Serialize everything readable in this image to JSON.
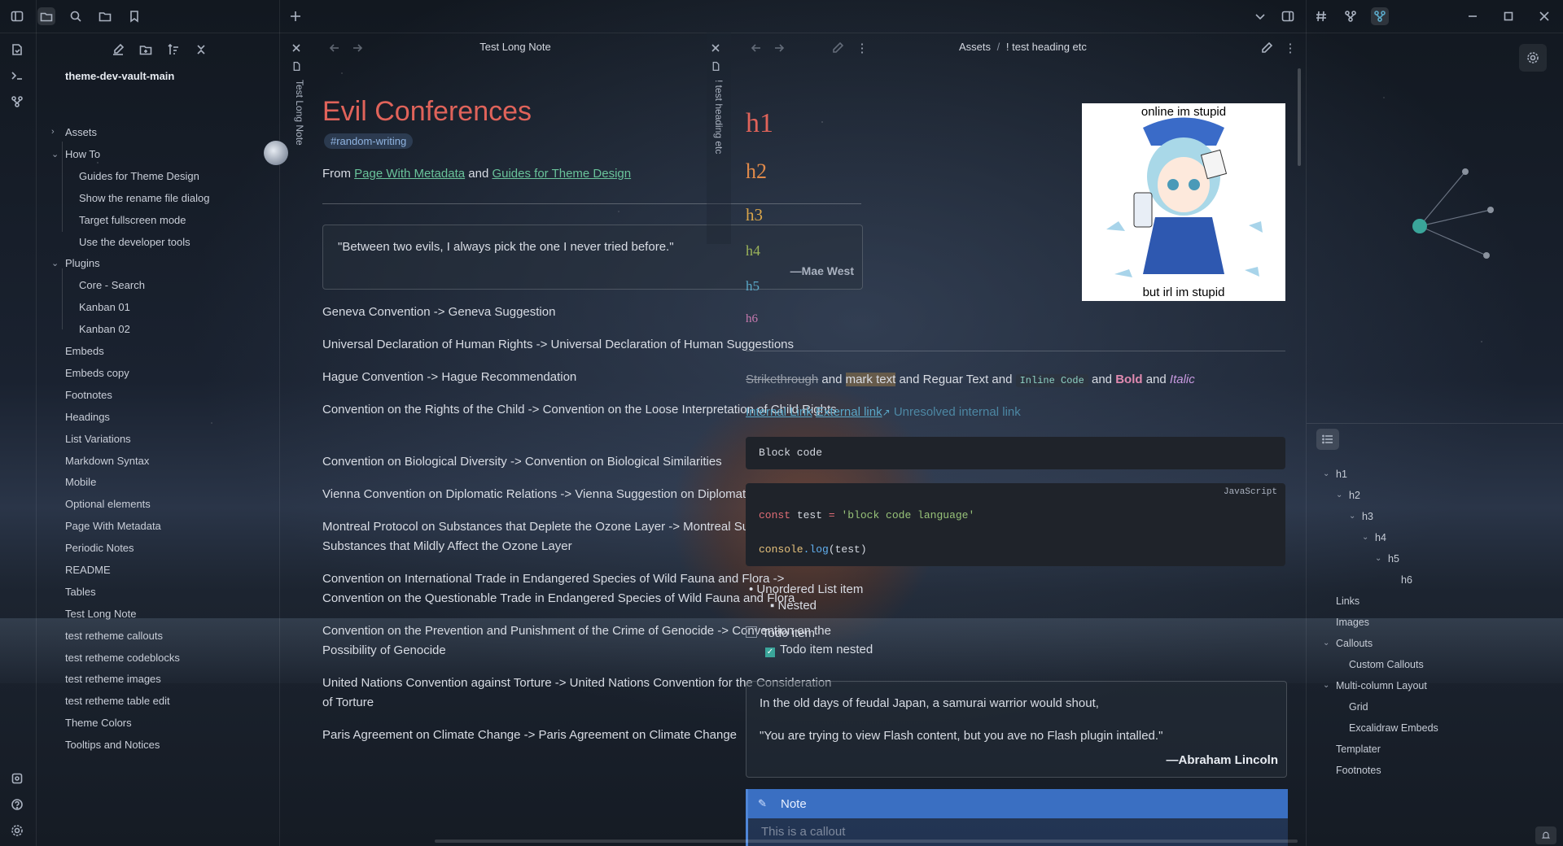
{
  "explorer": {
    "vault_name": "theme-dev-vault-main",
    "items": [
      {
        "label": "Assets",
        "type": "folder-collapsed"
      },
      {
        "label": "How To",
        "type": "folder-expanded"
      },
      {
        "label": "Guides for Theme Design",
        "type": "file"
      },
      {
        "label": "Show the rename file dialog",
        "type": "file"
      },
      {
        "label": "Target fullscreen mode",
        "type": "file"
      },
      {
        "label": "Use the developer tools",
        "type": "file"
      },
      {
        "label": "Plugins",
        "type": "folder-expanded"
      },
      {
        "label": "Core - Search",
        "type": "file"
      },
      {
        "label": "Kanban 01",
        "type": "file"
      },
      {
        "label": "Kanban 02",
        "type": "file"
      },
      {
        "label": "Embeds",
        "type": "file"
      },
      {
        "label": "Embeds copy",
        "type": "file"
      },
      {
        "label": "Footnotes",
        "type": "file"
      },
      {
        "label": "Headings",
        "type": "file"
      },
      {
        "label": "List Variations",
        "type": "file"
      },
      {
        "label": "Markdown Syntax",
        "type": "file"
      },
      {
        "label": "Mobile",
        "type": "file"
      },
      {
        "label": "Optional elements",
        "type": "file"
      },
      {
        "label": "Page With Metadata",
        "type": "file"
      },
      {
        "label": "Periodic Notes",
        "type": "file"
      },
      {
        "label": "README",
        "type": "file"
      },
      {
        "label": "Tables",
        "type": "file"
      },
      {
        "label": "Test Long Note",
        "type": "file"
      },
      {
        "label": "test retheme callouts",
        "type": "file"
      },
      {
        "label": "test retheme codeblocks",
        "type": "file"
      },
      {
        "label": "test retheme images",
        "type": "file"
      },
      {
        "label": "test retheme table edit",
        "type": "file"
      },
      {
        "label": "Theme Colors",
        "type": "file"
      },
      {
        "label": "Tooltips and Notices",
        "type": "file"
      }
    ]
  },
  "pane1": {
    "tab_title": "Test Long Note",
    "title": "Test Long Note",
    "heading": "Evil Conferences",
    "tag": "#random-writing",
    "from_prefix": "From ",
    "from_link1": "Page With Metadata",
    "from_and": " and ",
    "from_link2": "Guides for Theme Design",
    "quote": "\"Between two evils, I always pick the one I never tried before.\"",
    "quote_author": "—Mae West",
    "paragraphs": [
      "Geneva Convention -> Geneva Suggestion",
      "Universal Declaration of Human Rights -> Universal Declaration of Human Suggestions",
      "Hague Convention -> Hague Recommendation",
      "Convention on the Rights of the Child -> Convention on the Loose Interpretation of Child Rights",
      "Convention on Biological Diversity -> Convention on Biological Similarities",
      "Vienna Convention on Diplomatic Relations -> Vienna Suggestion on Diplomatic Relations",
      "Montreal Protocol on Substances that Deplete the Ozone Layer -> Montreal Suggestion on Substances that Mildly Affect the Ozone Layer",
      "Convention on International Trade in Endangered Species of Wild Fauna and Flora -> Convention on the Questionable Trade in Endangered Species of Wild Fauna and Flora",
      "Convention on the Prevention and Punishment of the Crime of Genocide -> Convention on the Possibility of Genocide",
      "United Nations Convention against Torture -> United Nations Convention for the Consideration of Torture",
      "Paris Agreement on Climate Change -> Paris Agreement on Climate Change"
    ]
  },
  "pane2": {
    "tab_title": "! test heading etc",
    "breadcrumb_folder": "Assets",
    "breadcrumb_sep": "/",
    "breadcrumb_file": "! test heading etc",
    "headings": [
      "h1",
      "h2",
      "h3",
      "h4",
      "h5",
      "h6"
    ],
    "heading_colors": [
      "#e0635a",
      "#e08a4a",
      "#d9a54a",
      "#9bb35a",
      "#5aa8c8",
      "#c87ab0"
    ],
    "meme_top": "online im stupid",
    "meme_bottom": "but irl im stupid",
    "format_line": {
      "strike": "Strikethrough",
      "and1": " and ",
      "mark": "mark text",
      "and2": " and Reguar Text and ",
      "code": "Inline Code",
      "and3": " and ",
      "bold": "Bold",
      "and4": " and ",
      "italic": "Italic"
    },
    "links_line": {
      "internal": "Internal Link",
      "external": "External link",
      "unresolved": "Unresolved internal link"
    },
    "block_code": "Block code",
    "code_lang": "JavaScript",
    "code_line1_kw": "const",
    "code_line1_var": " test ",
    "code_line1_op": "=",
    "code_line1_str": " 'block code language'",
    "code_line2_obj": "console",
    "code_line2_fn": ".log",
    "code_line2_arg": "(test)",
    "list_item": "Unordered List item",
    "list_nested": "Nested",
    "todo": "Todo item",
    "todo_nested": "Todo item nested",
    "quote_line1": "In the old days of feudal Japan, a samurai warrior would shout,",
    "quote_line2": "\"You are trying to view Flash content, but you ave no Flash plugin intalled.\"",
    "quote_author": "—Abraham Lincoln",
    "callout_title": "Note",
    "callout_body": "This is a callout"
  },
  "outline": {
    "items": [
      {
        "label": "h1",
        "level": 0,
        "chev": true
      },
      {
        "label": "h2",
        "level": 1,
        "chev": true
      },
      {
        "label": "h3",
        "level": 2,
        "chev": true
      },
      {
        "label": "h4",
        "level": 3,
        "chev": true
      },
      {
        "label": "h5",
        "level": 4,
        "chev": true
      },
      {
        "label": "h6",
        "level": 5,
        "chev": false
      },
      {
        "label": "Links",
        "level": 0,
        "chev": false
      },
      {
        "label": "Images",
        "level": 0,
        "chev": false
      },
      {
        "label": "Callouts",
        "level": 0,
        "chev": true
      },
      {
        "label": "Custom Callouts",
        "level": 1,
        "chev": false
      },
      {
        "label": "Multi-column Layout",
        "level": 0,
        "chev": true
      },
      {
        "label": "Grid",
        "level": 1,
        "chev": false
      },
      {
        "label": "Excalidraw Embeds",
        "level": 1,
        "chev": false
      },
      {
        "label": "Templater",
        "level": 0,
        "chev": false
      },
      {
        "label": "Footnotes",
        "level": 0,
        "chev": false
      }
    ]
  },
  "colors": {
    "accent": "#4f86d8",
    "heading_red": "#e0635a",
    "link_green": "#69c39a",
    "graph_node": "#3aa59a"
  }
}
